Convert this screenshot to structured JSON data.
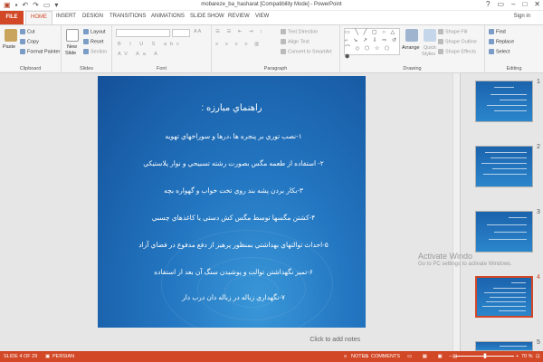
{
  "window": {
    "title": "mobareze_ba_hasharat [Compatibility Mode] - PowerPoint",
    "controls": [
      "?",
      "▭",
      "–",
      "□",
      "✕"
    ]
  },
  "tabs": [
    "FILE",
    "HOME",
    "INSERT",
    "DESIGN",
    "TRANSITIONS",
    "ANIMATIONS",
    "SLIDE SHOW",
    "REVIEW",
    "VIEW"
  ],
  "signin": "Sign in",
  "ribbon": {
    "clipboard": {
      "label": "Clipboard",
      "paste": "Paste",
      "cut": "Cut",
      "copy": "Copy",
      "format_painter": "Format Painter"
    },
    "slides": {
      "label": "Slides",
      "new_slide": "New",
      "new_slide2": "Slide",
      "layout": "Layout",
      "reset": "Reset",
      "section": "Section"
    },
    "font": {
      "label": "Font"
    },
    "paragraph": {
      "label": "Paragraph",
      "text_direction": "Text Direction",
      "align_text": "Align Text",
      "convert_smartart": "Convert to SmartArt"
    },
    "drawing": {
      "label": "Drawing",
      "arrange": "Arrange",
      "quick_styles": "Quick",
      "quick_styles2": "Styles",
      "shape_fill": "Shape Fill",
      "shape_outline": "Shape Outline",
      "shape_effects": "Shape Effects"
    },
    "editing": {
      "label": "Editing",
      "find": "Find",
      "replace": "Replace",
      "select": "Select"
    }
  },
  "slide": {
    "title": "راهنماي مبارزه :",
    "lines": [
      "۱-نصب توري بر پنجره ها ،درها و سوراخهاي تهويه",
      "۲- استفاده از طعمه مگس بصورت رشته تسبيحي و نوار پلاستيكي",
      "۳-بكار بردن پشه بند روي تخت خواب و گهواره بچه",
      "۴-كشتن مگسها توسط مگس كش دستي يا كاغذهاي چسبي",
      "۵-احداث توالتهاي بهداشتي بمنظور پرهيز از دفع مدفوع در فضاي آزاد",
      "۶-تميز نگهداشتن توالت و پوشيدن سنگ آن بعد از استفاده",
      "۷-نگهداري زباله در زباله دان درب دار"
    ]
  },
  "notes_placeholder": "Click to add notes",
  "watermark": {
    "line1": "Activate Windo",
    "line2": "Go to PC settings to activate Windows."
  },
  "thumbnails": [
    {
      "number": "1"
    },
    {
      "number": "2"
    },
    {
      "number": "3"
    },
    {
      "number": "4"
    },
    {
      "number": "5"
    }
  ],
  "status": {
    "slide_of": "SLIDE 4 OF 29",
    "language": "PERSIAN",
    "notes": "NOTES",
    "comments": "COMMENTS",
    "zoom": "70 %"
  },
  "colors": {
    "accent": "#d24726",
    "slide_blue": "#2376c1"
  }
}
